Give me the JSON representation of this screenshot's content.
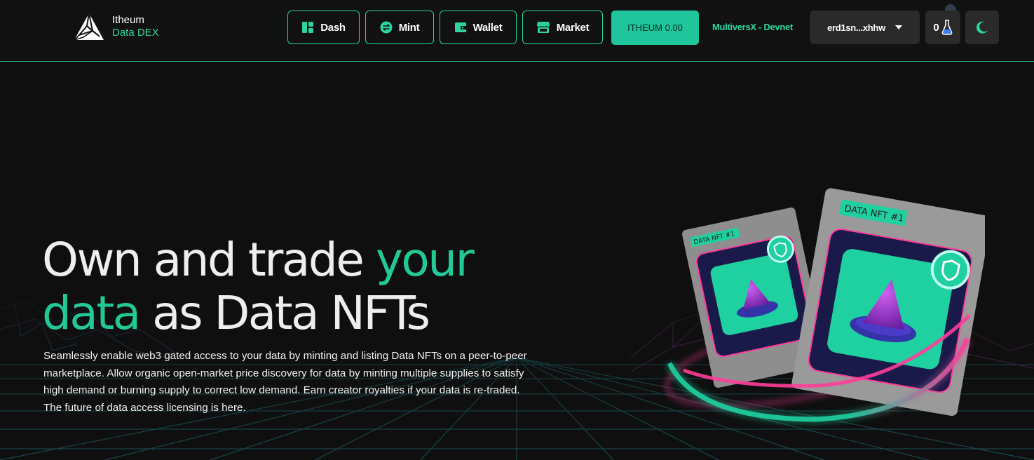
{
  "header": {
    "logo": {
      "line1": "Itheum",
      "line2": "Data DEX",
      "icon": "itheum-logo-icon"
    },
    "nav": [
      {
        "label": "Dash",
        "icon": "dashboard-icon"
      },
      {
        "label": "Mint",
        "icon": "exchange-icon"
      },
      {
        "label": "Wallet",
        "icon": "wallet-icon"
      },
      {
        "label": "Market",
        "icon": "store-icon"
      }
    ],
    "itheum_balance": "ITHEUM 0.00",
    "network": "MultiversX - Devnet",
    "address": "erd1sn...xhhw",
    "flask_count": "0"
  },
  "hero": {
    "headline_part1": "Own and trade ",
    "headline_accent1": "your",
    "headline_accent2": "data",
    "headline_part2": " as Data NFTs",
    "description": "Seamlessly enable web3 gated access to your data by minting and listing Data NFTs on a peer-to-peer marketplace. Allow organic open-market price discovery for data by minting multiple supplies to satisfy high demand or burning supply to correct low demand. Earn creator royalties if your data is re-traded. The future of data access licensing is here.",
    "card_back_label": "DATA NFT #1",
    "card_front_label": "DATA NFT #1"
  },
  "colors": {
    "accent": "#22c896",
    "button": "#1fc59b",
    "background": "#0f0f0f",
    "ring_pink": "#ff3d9a"
  }
}
